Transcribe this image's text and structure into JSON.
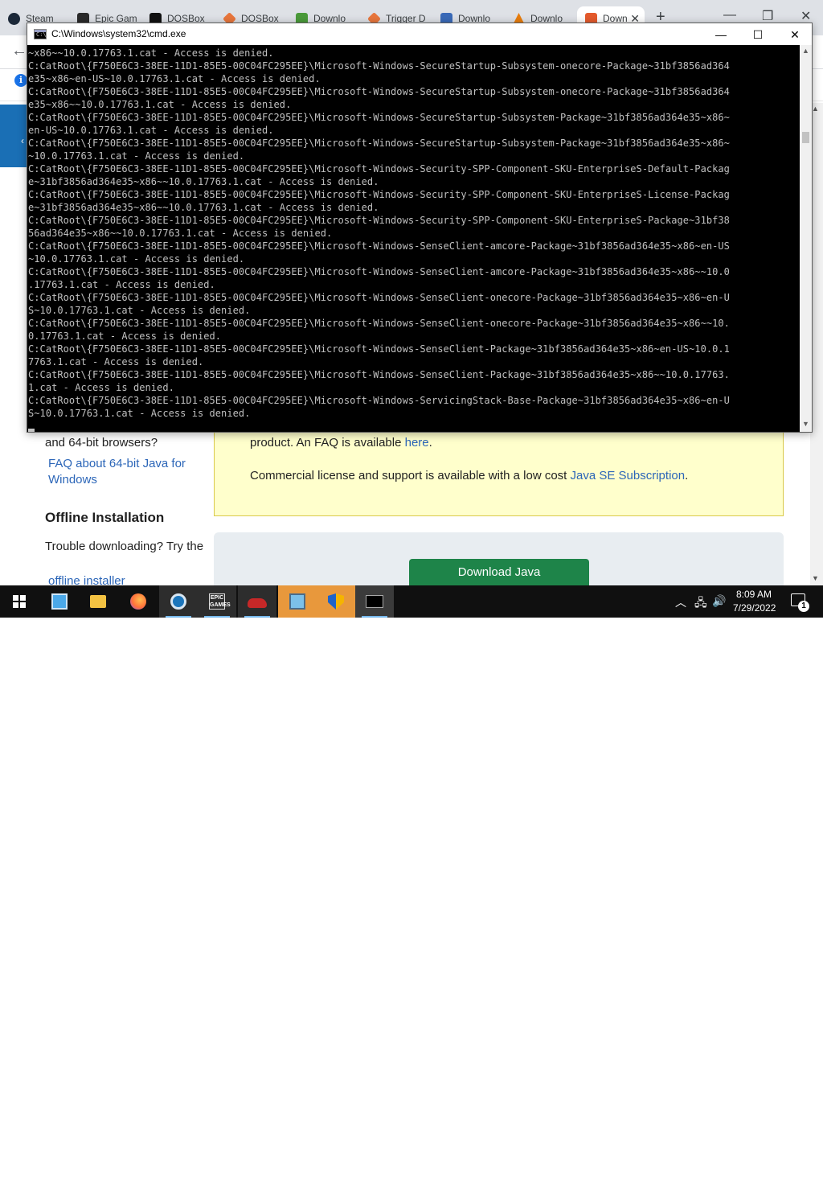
{
  "browser": {
    "tabs": [
      {
        "label": "Steam",
        "color": "#1b2838"
      },
      {
        "label": "Epic Gam",
        "color": "#2a2a2a"
      },
      {
        "label": "DOSBox",
        "color": "#111111"
      },
      {
        "label": "DOSBox",
        "color": "#e8763c"
      },
      {
        "label": "Downlo",
        "color": "#4a9a3a"
      },
      {
        "label": "Trigger D",
        "color": "#e8763c"
      },
      {
        "label": "Downlo",
        "color": "#3a6ab8"
      },
      {
        "label": "Downlo",
        "color": "#e87d0d"
      },
      {
        "label": "Down",
        "color": "#e45a2c"
      }
    ],
    "new_tab": "+",
    "page": {
      "bitness_question": "and 64-bit browsers?",
      "faq64_link": "FAQ about 64-bit Java for Windows",
      "offline_heading": "Offline Installation",
      "trouble_text": "Trouble downloading? Try the",
      "offline_link": "offline installer",
      "faq_line_prefix": "product. An FAQ is available ",
      "faq_line_link": "here",
      "faq_line_suffix": ".",
      "license_prefix": "Commercial license and support is available with a low cost ",
      "license_link": "Java SE Subscription",
      "license_suffix": ".",
      "download_button": "Download Java"
    }
  },
  "cmd": {
    "title": "C:\\Windows\\system32\\cmd.exe",
    "icon_text": "C:\\",
    "lines": [
      "~x86~~10.0.17763.1.cat - Access is denied.",
      "C:CatRoot\\{F750E6C3-38EE-11D1-85E5-00C04FC295EE}\\Microsoft-Windows-SecureStartup-Subsystem-onecore-Package~31bf3856ad364",
      "e35~x86~en-US~10.0.17763.1.cat - Access is denied.",
      "C:CatRoot\\{F750E6C3-38EE-11D1-85E5-00C04FC295EE}\\Microsoft-Windows-SecureStartup-Subsystem-onecore-Package~31bf3856ad364",
      "e35~x86~~10.0.17763.1.cat - Access is denied.",
      "C:CatRoot\\{F750E6C3-38EE-11D1-85E5-00C04FC295EE}\\Microsoft-Windows-SecureStartup-Subsystem-Package~31bf3856ad364e35~x86~",
      "en-US~10.0.17763.1.cat - Access is denied.",
      "C:CatRoot\\{F750E6C3-38EE-11D1-85E5-00C04FC295EE}\\Microsoft-Windows-SecureStartup-Subsystem-Package~31bf3856ad364e35~x86~",
      "~10.0.17763.1.cat - Access is denied.",
      "C:CatRoot\\{F750E6C3-38EE-11D1-85E5-00C04FC295EE}\\Microsoft-Windows-Security-SPP-Component-SKU-EnterpriseS-Default-Packag",
      "e~31bf3856ad364e35~x86~~10.0.17763.1.cat - Access is denied.",
      "C:CatRoot\\{F750E6C3-38EE-11D1-85E5-00C04FC295EE}\\Microsoft-Windows-Security-SPP-Component-SKU-EnterpriseS-License-Packag",
      "e~31bf3856ad364e35~x86~~10.0.17763.1.cat - Access is denied.",
      "C:CatRoot\\{F750E6C3-38EE-11D1-85E5-00C04FC295EE}\\Microsoft-Windows-Security-SPP-Component-SKU-EnterpriseS-Package~31bf38",
      "56ad364e35~x86~~10.0.17763.1.cat - Access is denied.",
      "C:CatRoot\\{F750E6C3-38EE-11D1-85E5-00C04FC295EE}\\Microsoft-Windows-SenseClient-amcore-Package~31bf3856ad364e35~x86~en-US",
      "~10.0.17763.1.cat - Access is denied.",
      "C:CatRoot\\{F750E6C3-38EE-11D1-85E5-00C04FC295EE}\\Microsoft-Windows-SenseClient-amcore-Package~31bf3856ad364e35~x86~~10.0",
      ".17763.1.cat - Access is denied.",
      "C:CatRoot\\{F750E6C3-38EE-11D1-85E5-00C04FC295EE}\\Microsoft-Windows-SenseClient-onecore-Package~31bf3856ad364e35~x86~en-U",
      "S~10.0.17763.1.cat - Access is denied.",
      "C:CatRoot\\{F750E6C3-38EE-11D1-85E5-00C04FC295EE}\\Microsoft-Windows-SenseClient-onecore-Package~31bf3856ad364e35~x86~~10.",
      "0.17763.1.cat - Access is denied.",
      "C:CatRoot\\{F750E6C3-38EE-11D1-85E5-00C04FC295EE}\\Microsoft-Windows-SenseClient-Package~31bf3856ad364e35~x86~en-US~10.0.1",
      "7763.1.cat - Access is denied.",
      "C:CatRoot\\{F750E6C3-38EE-11D1-85E5-00C04FC295EE}\\Microsoft-Windows-SenseClient-Package~31bf3856ad364e35~x86~~10.0.17763.",
      "1.cat - Access is denied.",
      "C:CatRoot\\{F750E6C3-38EE-11D1-85E5-00C04FC295EE}\\Microsoft-Windows-ServicingStack-Base-Package~31bf3856ad364e35~x86~en-U",
      "S~10.0.17763.1.cat - Access is denied."
    ]
  },
  "taskbar": {
    "apps": [
      {
        "name": "control-panel",
        "icon": "control-panel-icon",
        "color": "#4aa8e8"
      },
      {
        "name": "file-explorer",
        "icon": "folder-icon",
        "color": "#f3c242"
      },
      {
        "name": "firefox",
        "icon": "firefox-icon",
        "color": "#ff7139"
      },
      {
        "name": "steam",
        "icon": "steam-icon",
        "color": "#1b75bb"
      },
      {
        "name": "epic-games",
        "icon": "epic-games-icon",
        "color": "#2f2f2f"
      },
      {
        "name": "game",
        "icon": "car-icon",
        "color": "#c62828"
      },
      {
        "name": "dosbox",
        "icon": "dosbox-icon",
        "color": "#7cc0e8"
      },
      {
        "name": "windows-security",
        "icon": "shield-icon",
        "color": "#f5b400"
      },
      {
        "name": "cmd",
        "icon": "cmd-icon",
        "color": "#1a1a1a"
      }
    ],
    "clock_time": "8:09 AM",
    "clock_date": "7/29/2022",
    "notification_count": "1"
  }
}
